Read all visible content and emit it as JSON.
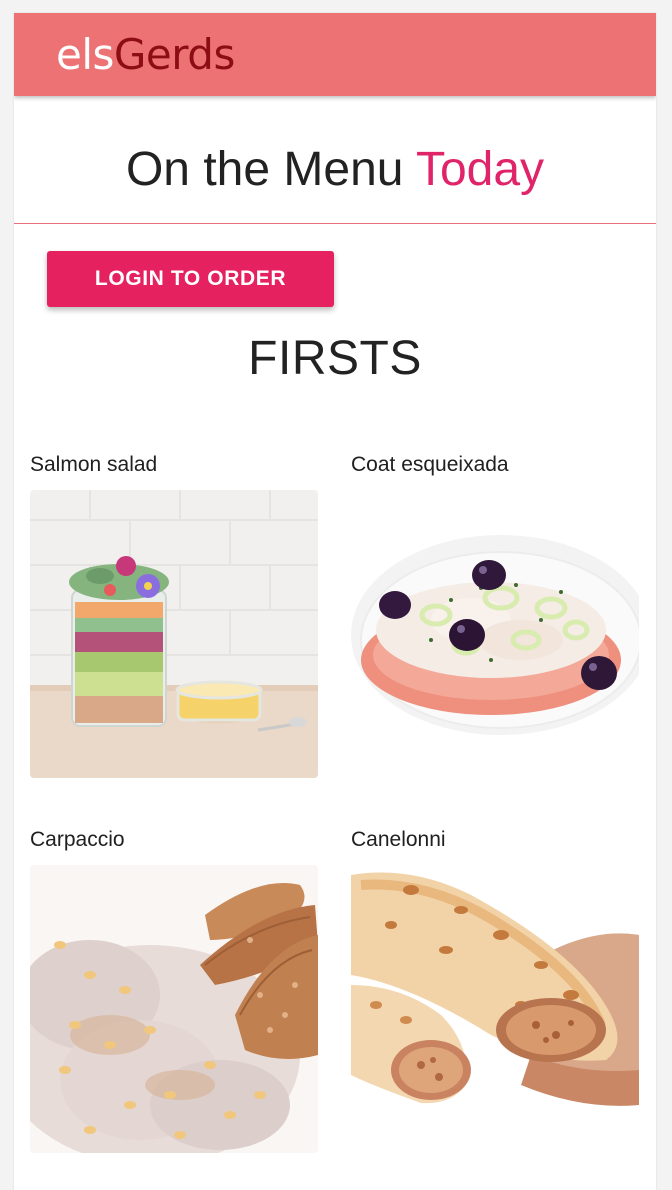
{
  "header": {
    "brand_part1": "els",
    "brand_part2": "Gerds"
  },
  "hero": {
    "title_main": "On the Menu ",
    "title_accent": "Today"
  },
  "actions": {
    "login_label": "LOGIN TO ORDER"
  },
  "section": {
    "title": "FIRSTS"
  },
  "dishes": [
    {
      "name": "Salmon salad",
      "icon": "salad-jar-image"
    },
    {
      "name": "Coat esqueixada",
      "icon": "esqueixada-plate-image"
    },
    {
      "name": "Carpaccio",
      "icon": "carpaccio-image"
    },
    {
      "name": "Canelonni",
      "icon": "cannelloni-image"
    }
  ],
  "colors": {
    "appbar": "#ec7274",
    "brand_dark": "#8c0d14",
    "accent": "#e0246a",
    "button": "#e5215f"
  }
}
